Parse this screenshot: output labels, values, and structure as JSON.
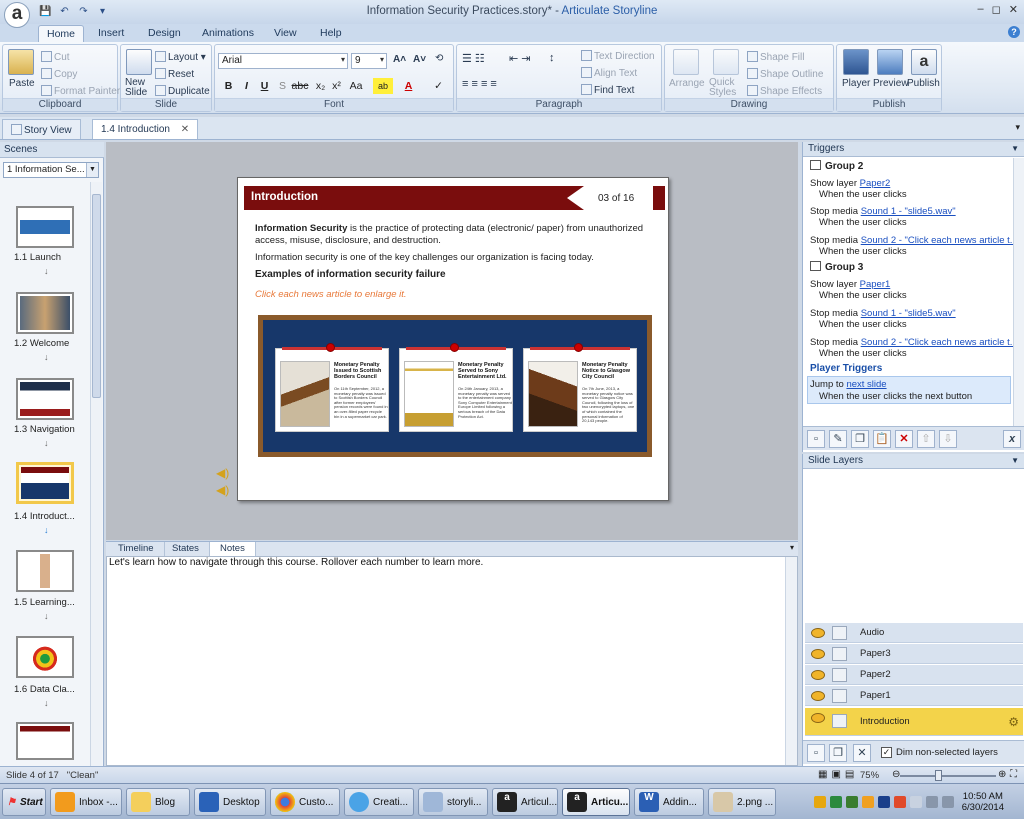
{
  "window": {
    "title": "Information Security Practices.story*",
    "app": "Articulate Storyline",
    "separator": " - ",
    "controls": [
      "–",
      "◻",
      "✕"
    ]
  },
  "ribbon": {
    "tabs": [
      "Home",
      "Insert",
      "Design",
      "Animations",
      "View",
      "Help"
    ],
    "active_tab": "Home",
    "clipboard": {
      "paste": "Paste",
      "cut": "Cut",
      "copy": "Copy",
      "format_painter": "Format Painter",
      "label": "Clipboard"
    },
    "slide": {
      "new_slide": "New Slide",
      "layout": "Layout",
      "reset": "Reset",
      "duplicate": "Duplicate",
      "label": "Slide"
    },
    "font": {
      "family": "Arial",
      "size": "9",
      "label": "Font",
      "bold": "B",
      "italic": "I",
      "underline": "U",
      "strike": "abc",
      "sub": "x₂",
      "sup": "x²",
      "case": "Aa"
    },
    "paragraph": {
      "text_direction": "Text Direction",
      "align_text": "Align Text",
      "find_text": "Find Text",
      "label": "Paragraph"
    },
    "drawing": {
      "arrange": "Arrange",
      "quick_styles": "Quick Styles",
      "shape_fill": "Shape Fill",
      "shape_outline": "Shape Outline",
      "shape_effects": "Shape Effects",
      "label": "Drawing"
    },
    "publish": {
      "player": "Player",
      "preview": "Preview",
      "publish": "Publish",
      "label": "Publish"
    }
  },
  "doc_tabs": [
    "Story View",
    "1.4 Introduction"
  ],
  "scenes": {
    "header": "Scenes",
    "selected": "1 Information Se...",
    "slides": [
      {
        "label": "1.1 Launch"
      },
      {
        "label": "1.2 Welcome"
      },
      {
        "label": "1.3 Navigation"
      },
      {
        "label": "1.4 Introduct...",
        "active": true
      },
      {
        "label": "1.5 Learning..."
      },
      {
        "label": "1.6 Data Cla..."
      }
    ]
  },
  "slide": {
    "banner": "Introduction",
    "page": "03 of 16",
    "para1_bold": "Information Security",
    "para1_rest": " is the practice of protecting data (electronic/ paper) from unauthorized access, misuse, disclosure, and destruction.",
    "para2": "Information security is one of the key challenges our organization is facing today.",
    "examples_heading": "Examples of information security failure",
    "click_hint": "Click each news article to enlarge it.",
    "cards": [
      {
        "title": "Monetary Penalty Issued to Scottish Borders Council",
        "body": "On 11th September, 2012, a monetary penalty was issued to Scottish Borders Council after former employees' pension records were found in an over-filled paper recycle bin in a supermarket car park."
      },
      {
        "title": "Monetary Penalty Served to Sony Entertainment Ltd.",
        "body": "On 24th January, 2013, a monetary penalty was served to the entertainment company Sony Computer Entertainment Europe Limited following a serious breach of the Data Protection Act."
      },
      {
        "title": "Monetary Penalty Notice to Glasgow City Council",
        "body": "On 7th June, 2013, a monetary penalty notice was served to Glasgow City Council, following the loss of two unencrypted laptops, one of which contained the personal information of 20,143 people."
      }
    ]
  },
  "bottom": {
    "tabs": [
      "Timeline",
      "States",
      "Notes"
    ],
    "active_tab": "Notes",
    "notes": "Let's learn how to navigate through this course. Rollover each number to learn more."
  },
  "triggers": {
    "header": "Triggers",
    "group2": "Group 2",
    "group3": "Group 3",
    "player_triggers": "Player Triggers",
    "g2": [
      {
        "action": "Show layer ",
        "link": "Paper2",
        "when": "When the user clicks"
      },
      {
        "action": "Stop media ",
        "link": "Sound 1 - \"slide5.wav\"",
        "when": "When the user clicks"
      },
      {
        "action": "Stop media ",
        "link": "Sound 2 - \"Click each news article t...",
        "when": "When the user clicks"
      }
    ],
    "g3": [
      {
        "action": "Show layer ",
        "link": "Paper1",
        "when": "When the user clicks"
      },
      {
        "action": "Stop media ",
        "link": "Sound 1 - \"slide5.wav\"",
        "when": "When the user clicks"
      },
      {
        "action": "Stop media ",
        "link": "Sound 2 - \"Click each news article t...",
        "when": "When the user clicks"
      }
    ],
    "player": {
      "action": "Jump to ",
      "link": "next slide",
      "when": "When the user clicks the next button"
    }
  },
  "layers": {
    "header": "Slide Layers",
    "items": [
      "Audio",
      "Paper3",
      "Paper2",
      "Paper1"
    ],
    "base": "Introduction",
    "dim_label": "Dim non-selected layers",
    "dim_checked": "✓"
  },
  "status": {
    "slide_info": "Slide 4 of 17",
    "theme": "\"Clean\"",
    "zoom": "75%"
  },
  "taskbar": {
    "start": "Start",
    "items": [
      "Inbox -...",
      "Blog",
      "Desktop",
      "Custo...",
      "Creati...",
      "storyli...",
      "Articul...",
      "Articu...",
      "Addin...",
      "2.png ..."
    ],
    "time": "10:50 AM",
    "date": "6/30/2014"
  },
  "colors": {
    "banner": "#7a0d0d",
    "board": "#17376a",
    "layer_selected": "#f3d34a",
    "link": "#1a4fc0"
  }
}
